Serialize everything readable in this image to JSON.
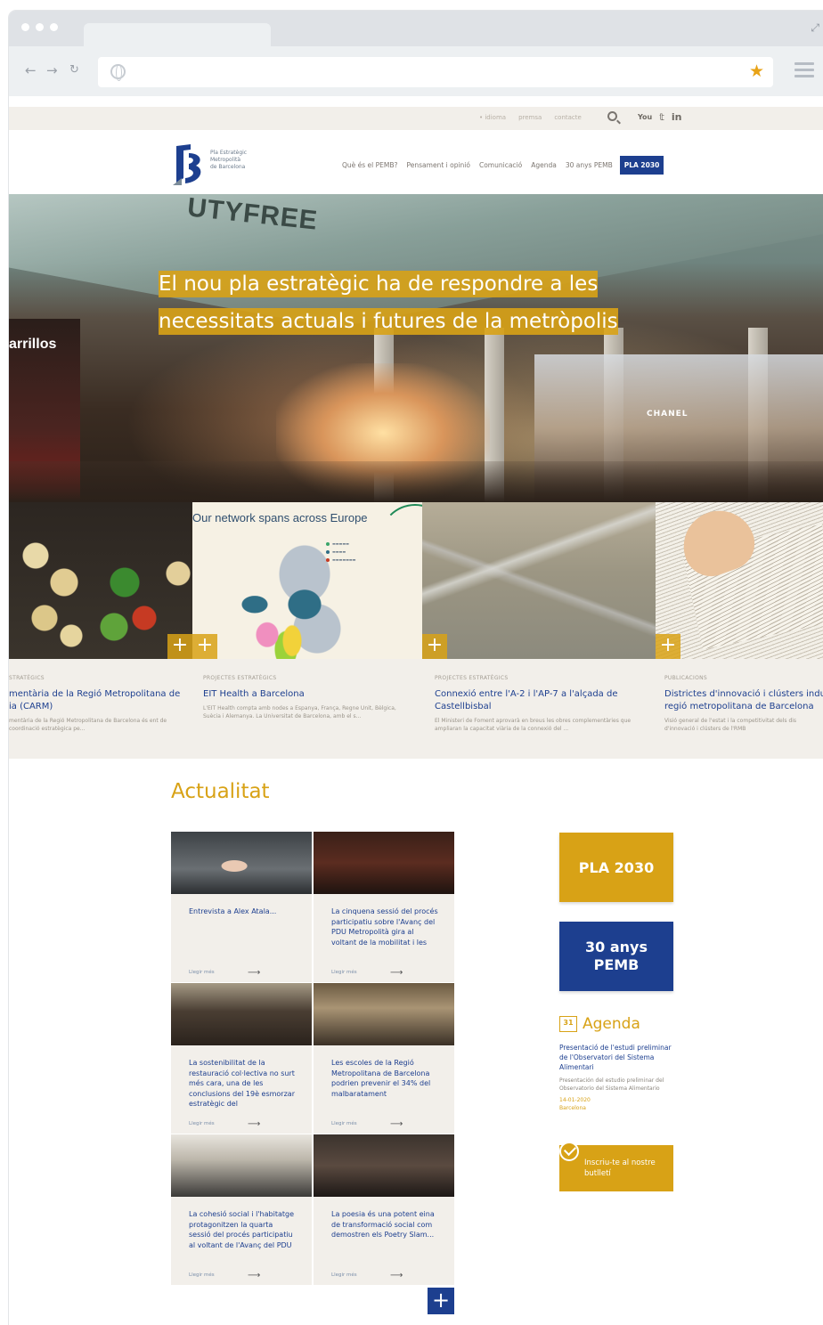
{
  "browser": {
    "url": "",
    "colors": {
      "chrome": "#dfe2e6",
      "star": "#e8a317"
    }
  },
  "utility_nav": {
    "links": [
      "• idioma",
      "premsa",
      "contacte"
    ],
    "social": [
      "You",
      "𝕥",
      "in"
    ]
  },
  "site": {
    "logo_text": [
      "Pla Estratègic",
      "Metropolità",
      "de Barcelona"
    ],
    "nav": [
      "Què és el PEMB?",
      "Pensament i opinió",
      "Comunicació",
      "Agenda",
      "30 anys PEMB"
    ],
    "nav_highlight": "PLA 2030"
  },
  "hero": {
    "title_line1": "El nou pla estratègic ha de respondre a les",
    "title_line2": "necessitats actuals i futures de la metròpolis",
    "sign_dutyfree": "UTYFREE",
    "sign_left": "arrillos",
    "sign_chanel": "CHANEL"
  },
  "tiles": [
    {
      "kicker": "STRATÈGICS",
      "title_line1": "mentària de la Regió Metropolitana de",
      "title_line2": "ia (CARM)",
      "desc": "mentària de la Regió Metropolitana de Barcelona és ent de coordinació estratègica pe..."
    },
    {
      "kicker": "PROJECTES ESTRATÈGICS",
      "title_line1": "EIT Health a Barcelona",
      "title_line2": "",
      "desc": "L'EIT Health compta amb nodes a Espanya, França, Regne Unit, Bèlgica, Suècia i Alemanya. La Universitat de Barcelona, amb el s..."
    },
    {
      "kicker": "PROJECTES ESTRATÈGICS",
      "title_line1": "Connexió entre l'A-2 i l'AP-7 a l'alçada de",
      "title_line2": "Castellbisbal",
      "desc": "El Ministeri de Foment aprovarà en breus les obres complementàries que ampliaran la capacitat viària de la connexió del ..."
    },
    {
      "kicker": "PUBLICACIONS",
      "title_line1": "Districtes d'innovació i clústers indus",
      "title_line2": "regió metropolitana de Barcelona",
      "desc": "Visió general de l'estat i la competitivitat dels dis d'innovació i clústers de l'RMB"
    }
  ],
  "tile_network": {
    "title": "Our network spans across Europe"
  },
  "news": {
    "section_title": "Actualitat",
    "read_more": "Llegir més",
    "items": [
      {
        "title": "Entrevista a Alex Atala..."
      },
      {
        "title": "La cinquena sessió del procés participatiu sobre l'Avanç del PDU Metropolità gira al voltant de la mobilitat i les"
      },
      {
        "title": "La sostenibilitat de la restauració col·lectiva no surt més cara, una de les conclusions del 19è esmorzar estratègic del"
      },
      {
        "title": "Les escoles de la Regió Metropolitana de Barcelona podrien prevenir el 34% del malbaratament"
      },
      {
        "title": "La cohesió social i l'habitatge protagonitzen la quarta sessió del procés participatiu al voltant de l'Avanç del PDU"
      },
      {
        "title": "La poesia és una potent eina de transformació social com demostren els Poetry Slam..."
      }
    ]
  },
  "sidebar": {
    "pla_button": "PLA 2030",
    "anys_button_line1": "30 anys",
    "anys_button_line2": "PEMB",
    "agenda_title": "Agenda",
    "agenda_day": "31",
    "agenda_event_title": "Presentació de l'estudi preliminar de l'Observatori del Sistema Alimentari",
    "agenda_event_desc": "Presentación del estudio preliminar del Observatorio del Sistema Alimentario",
    "agenda_event_date": "14-01-2020",
    "agenda_event_place": "Barcelona",
    "newsletter": "Inscriu-te al nostre butlletí"
  },
  "colors": {
    "brand_blue": "#1d3f8f",
    "brand_gold": "#d8a216",
    "beige": "#f2efea"
  }
}
